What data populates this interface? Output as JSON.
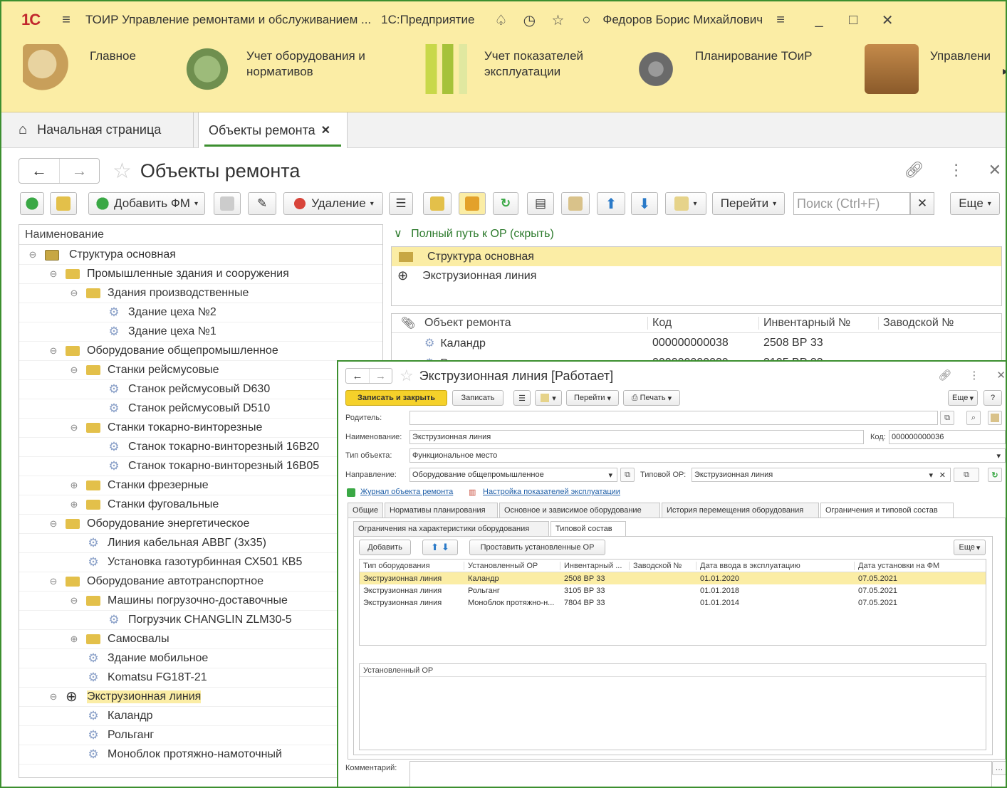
{
  "titlebar": {
    "logo": "1С",
    "app_title": "ТОИР Управление ремонтами и обслуживанием ...",
    "platform": "1С:Предприятие",
    "user": "Федоров Борис Михайлович"
  },
  "sections": [
    {
      "label": "Главное",
      "color": "#d9b36a"
    },
    {
      "label": "Учет оборудования и нормативов",
      "color": "#7fa05a"
    },
    {
      "label": "Учет показателей эксплуатации",
      "color": "#b8c84a"
    },
    {
      "label": "Планирование ТОиР",
      "color": "#8a8a8a"
    },
    {
      "label": "Управлени",
      "color": "#b07a3a"
    }
  ],
  "tabs": {
    "home": "Начальная страница",
    "current": "Объекты ремонта"
  },
  "form": {
    "title": "Объекты ремонта",
    "toolbar": {
      "add_fm": "Добавить ФМ",
      "delete": "Удаление",
      "goto": "Перейти",
      "search_placeholder": "Поиск (Ctrl+F)",
      "more": "Еще"
    },
    "tree_header": "Наименование",
    "tree": [
      {
        "label": "Структура основная",
        "level": 0,
        "kind": "root",
        "exp": "⊖"
      },
      {
        "label": "Промышленные здания и сооружения",
        "level": 1,
        "kind": "folder",
        "exp": "⊖"
      },
      {
        "label": "Здания производственные",
        "level": 2,
        "kind": "folder",
        "exp": "⊖"
      },
      {
        "label": "Здание цеха №2",
        "level": 3,
        "kind": "gear",
        "exp": ""
      },
      {
        "label": "Здание цеха №1",
        "level": 3,
        "kind": "gear",
        "exp": ""
      },
      {
        "label": "Оборудование общепромышленное",
        "level": 1,
        "kind": "folder",
        "exp": "⊖"
      },
      {
        "label": "Станки рейсмусовые",
        "level": 2,
        "kind": "folder",
        "exp": "⊖"
      },
      {
        "label": "Станок рейсмусовый D630",
        "level": 3,
        "kind": "gear",
        "exp": ""
      },
      {
        "label": "Станок рейсмусовый D510",
        "level": 3,
        "kind": "gear",
        "exp": ""
      },
      {
        "label": "Станки токарно-винторезные",
        "level": 2,
        "kind": "folder",
        "exp": "⊖"
      },
      {
        "label": "Станок токарно-винторезный 16В20",
        "level": 3,
        "kind": "gear",
        "exp": ""
      },
      {
        "label": "Станок токарно-винторезный 16В05",
        "level": 3,
        "kind": "gear",
        "exp": ""
      },
      {
        "label": "Станки фрезерные",
        "level": 2,
        "kind": "folder",
        "exp": "⊕"
      },
      {
        "label": "Станки фуговальные",
        "level": 2,
        "kind": "folder",
        "exp": "⊕"
      },
      {
        "label": "Оборудование энергетическое",
        "level": 1,
        "kind": "folder",
        "exp": "⊖"
      },
      {
        "label": "Линия кабельная АВВГ (3х35)",
        "level": 2,
        "kind": "gear",
        "exp": ""
      },
      {
        "label": "Установка газотурбинная СХ501 КВ5",
        "level": 2,
        "kind": "gear",
        "exp": ""
      },
      {
        "label": "Оборудование автотранспортное",
        "level": 1,
        "kind": "folder",
        "exp": "⊖"
      },
      {
        "label": "Машины погрузочно-доставочные",
        "level": 2,
        "kind": "folder",
        "exp": "⊖"
      },
      {
        "label": "Погрузчик CHANGLIN ZLM30-5",
        "level": 3,
        "kind": "gear",
        "exp": ""
      },
      {
        "label": "Самосвалы",
        "level": 2,
        "kind": "folder",
        "exp": "⊕"
      },
      {
        "label": "Здание мобильное",
        "level": 2,
        "kind": "gear",
        "exp": ""
      },
      {
        "label": "Komatsu FG18T-21",
        "level": 2,
        "kind": "gear",
        "exp": ""
      },
      {
        "label": "Экструзионная линия",
        "level": 1,
        "kind": "target",
        "exp": "⊖",
        "selected": true
      },
      {
        "label": "Каландр",
        "level": 2,
        "kind": "gear",
        "exp": ""
      },
      {
        "label": "Рольганг",
        "level": 2,
        "kind": "gear",
        "exp": ""
      },
      {
        "label": "Моноблок протяжно-намоточный",
        "level": 2,
        "kind": "gear",
        "exp": ""
      }
    ],
    "path_toggle": "Полный путь к ОР (скрыть)",
    "path": [
      "Структура основная",
      "Экструзионная линия"
    ],
    "objects_table": {
      "columns": [
        "Объект ремонта",
        "Код",
        "Инвентарный №",
        "Заводской №"
      ],
      "rows": [
        [
          "Каландр",
          "000000000038",
          "2508 ВР 33",
          ""
        ],
        [
          "Р",
          "000000000039",
          "3105 ВР 33",
          ""
        ]
      ]
    }
  },
  "popup": {
    "title": "Экструзионная линия [Работает]",
    "buttons": {
      "save_close": "Записать и закрыть",
      "save": "Записать",
      "goto": "Перейти",
      "print": "Печать",
      "more": "Еще",
      "help": "?"
    },
    "fields": {
      "parent_label": "Родитель:",
      "parent_value": "",
      "name_label": "Наименование:",
      "name_value": "Экструзионная линия",
      "code_label": "Код:",
      "code_value": "000000000036",
      "type_label": "Тип объекта:",
      "type_value": "Функциональное место",
      "direction_label": "Направление:",
      "direction_value": "Оборудование общепромышленное",
      "typical_label": "Типовой ОР:",
      "typical_value": "Экструзионная линия"
    },
    "links": {
      "journal": "Журнал объекта ремонта",
      "indicators": "Настройка показателей эксплуатации"
    },
    "tabs": [
      "Общие",
      "Нормативы планирования",
      "Основное и зависимое оборудование",
      "История перемещения оборудования",
      "Ограничения и типовой состав"
    ],
    "subtabs": [
      "Ограничения на характеристики оборудования",
      "Типовой состав"
    ],
    "sub_buttons": {
      "add": "Добавить",
      "set_installed": "Проставить установленные ОР",
      "more": "Еще"
    },
    "table": {
      "columns": [
        "Тип оборудования",
        "Установленный ОР",
        "Инвентарный ...",
        "Заводской №",
        "Дата ввода в эксплуатацию",
        "Дата установки на ФМ"
      ],
      "rows": [
        [
          "Экструзионная линия",
          "Каландр",
          "2508 ВР 33",
          "",
          "01.01.2020",
          "07.05.2021"
        ],
        [
          "Экструзионная линия",
          "Рольганг",
          "3105 ВР 33",
          "",
          "01.01.2018",
          "07.05.2021"
        ],
        [
          "Экструзионная линия",
          "Моноблок протяжно-н...",
          "7804 ВР 33",
          "",
          "01.01.2014",
          "07.05.2021"
        ]
      ]
    },
    "installed_header": "Установленный ОР",
    "comment_label": "Комментарий:"
  }
}
